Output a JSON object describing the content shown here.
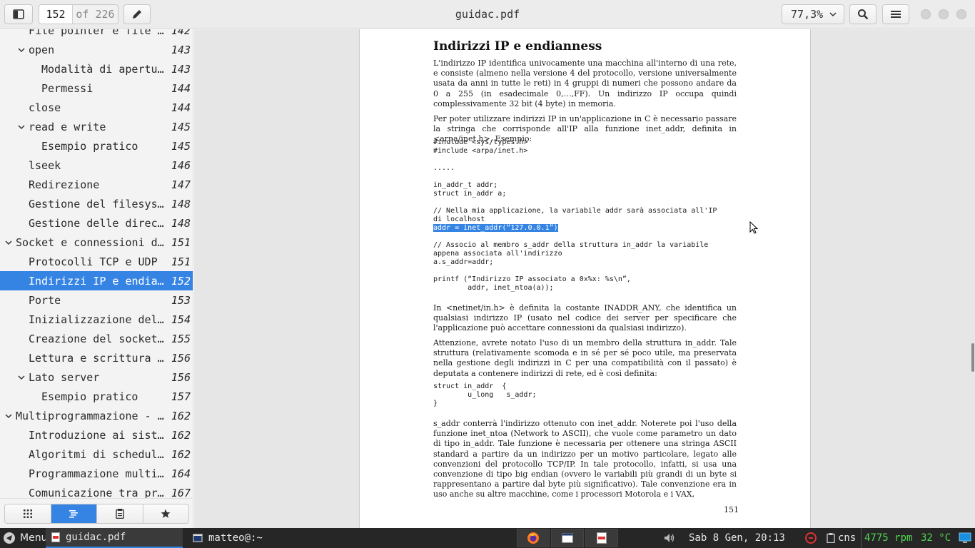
{
  "header": {
    "title": "guidac.pdf",
    "page_current": "152",
    "page_total": "of 226",
    "zoom": "77,3%"
  },
  "sidebar": {
    "items": [
      {
        "label": "File pointer e file des…",
        "page": "142",
        "level": 1,
        "expander": false
      },
      {
        "label": "open",
        "page": "143",
        "level": 1,
        "expander": true
      },
      {
        "label": "Modalità di apertura",
        "page": "143",
        "level": 2,
        "expander": false
      },
      {
        "label": "Permessi",
        "page": "144",
        "level": 2,
        "expander": false
      },
      {
        "label": "close",
        "page": "144",
        "level": 1,
        "expander": false
      },
      {
        "label": "read e write",
        "page": "145",
        "level": 1,
        "expander": true
      },
      {
        "label": "Esempio pratico",
        "page": "145",
        "level": 2,
        "expander": false
      },
      {
        "label": "lseek",
        "page": "146",
        "level": 1,
        "expander": false
      },
      {
        "label": "Redirezione",
        "page": "147",
        "level": 1,
        "expander": false
      },
      {
        "label": "Gestione del filesystem…",
        "page": "148",
        "level": 1,
        "expander": false
      },
      {
        "label": "Gestione delle directory",
        "page": "148",
        "level": 1,
        "expander": false
      },
      {
        "label": "Socket e connessioni di r…",
        "page": "151",
        "level": 0,
        "expander": true
      },
      {
        "label": "Protocolli TCP e UDP",
        "page": "151",
        "level": 1,
        "expander": false
      },
      {
        "label": "Indirizzi IP e endianne…",
        "page": "152",
        "level": 1,
        "expander": false,
        "selected": true
      },
      {
        "label": "Porte",
        "page": "153",
        "level": 1,
        "expander": false
      },
      {
        "label": "Inizializzazione dell'i…",
        "page": "154",
        "level": 1,
        "expander": false
      },
      {
        "label": "Creazione del socket e …",
        "page": "155",
        "level": 1,
        "expander": false
      },
      {
        "label": "Lettura e scrittura di …",
        "page": "156",
        "level": 1,
        "expander": false
      },
      {
        "label": "Lato server",
        "page": "156",
        "level": 1,
        "expander": true
      },
      {
        "label": "Esempio pratico",
        "page": "157",
        "level": 2,
        "expander": false
      },
      {
        "label": "Multiprogrammazione - pro…",
        "page": "162",
        "level": 0,
        "expander": true
      },
      {
        "label": "Introduzione ai sistemi…",
        "page": "162",
        "level": 1,
        "expander": false
      },
      {
        "label": "Algoritmi di scheduling",
        "page": "162",
        "level": 1,
        "expander": false
      },
      {
        "label": "Programmazione multipro…",
        "page": "164",
        "level": 1,
        "expander": false
      },
      {
        "label": "Comunicazione tra proce…",
        "page": "167",
        "level": 1,
        "expander": false
      }
    ]
  },
  "document": {
    "heading": "Indirizzi IP e endianness",
    "p1": "L'indirizzo IP identifica univocamente una macchina all'interno di una rete, e consiste (almeno nella versione 4 del protocollo, versione universalmente usata da anni in tutte le reti) in 4 gruppi di numeri che possono andare da 0 a 255 (in esadecimale 0,…,FF). Un indirizzo IP occupa quindi complessivamente 32 bit (4 byte) in memoria.",
    "p2": "Per poter utilizzare indirizzi IP in un'applicazione in C è necessario passare la stringa che corrisponde all'IP alla funzione inet_addr, definita in <arpa/inet.h>. Esempio:",
    "code1": "#include <sys/types.h>\n#include <arpa/inet.h>\n\n.....\n\nin_addr_t addr;\nstruct in_addr a;\n\n// Nella mia applicazione, la variabile addr sarà associata all'IP\ndi localhost",
    "code_selected": "addr = inet_addr(“127.0.0.1”)",
    "code2": "// Associo al membro s_addr della struttura in_addr la variabile\nappena associata all'indirizzo\na.s_addr=addr;\n\nprintf (“Indirizzo IP associato a 0x%x: %s\\n”,\n        addr, inet_ntoa(a));",
    "p3": "In <netinet/in.h> è definita la costante INADDR_ANY, che identifica un qualsiasi indirizzo IP (usato nel codice dei server per specificare che l'applicazione può accettare connessioni da qualsiasi indirizzo).",
    "p4": "Attenzione, avrete notato l'uso di un membro della struttura in_addr. Tale struttura (relativamente scomoda e in sé per sé poco utile, ma preservata nella gestione degli indirizzi in C per una compatibilità con il passato) è deputata a contenere indirizzi di rete, ed è così definita:",
    "code3": "struct in_addr  {\n        u_long   s_addr;\n}",
    "p5": "s_addr conterrà l'indirizzo ottenuto con inet_addr. Noterete poi l'uso della funzione inet_ntoa (Network to ASCII), che vuole come parametro un dato di tipo in_addr. Tale funzione è necessaria per ottenere una stringa ASCII standard a partire da un indirizzo per un motivo particolare, legato alle convenzioni del protocollo TCP/IP. In tale protocollo, infatti, si usa una convenzione di tipo big endian (ovvero le variabili più grandi di un byte si rappresentano a partire dal byte più significativo). Tale convenzione era in uso anche su altre macchine, come i processori Motorola e i VAX,",
    "page_number": "151"
  },
  "taskbar": {
    "menu_label": "Menu",
    "window1": "guidac.pdf",
    "window2": "matteo@:~",
    "datetime": "Sab   8 Gen, 20:13",
    "layout": "cns",
    "fan": "4775 rpm",
    "temp": "32 °C"
  },
  "colors": {
    "accent": "#3584e4",
    "taskbar": "#262626",
    "monitor_green": "#52d452"
  }
}
